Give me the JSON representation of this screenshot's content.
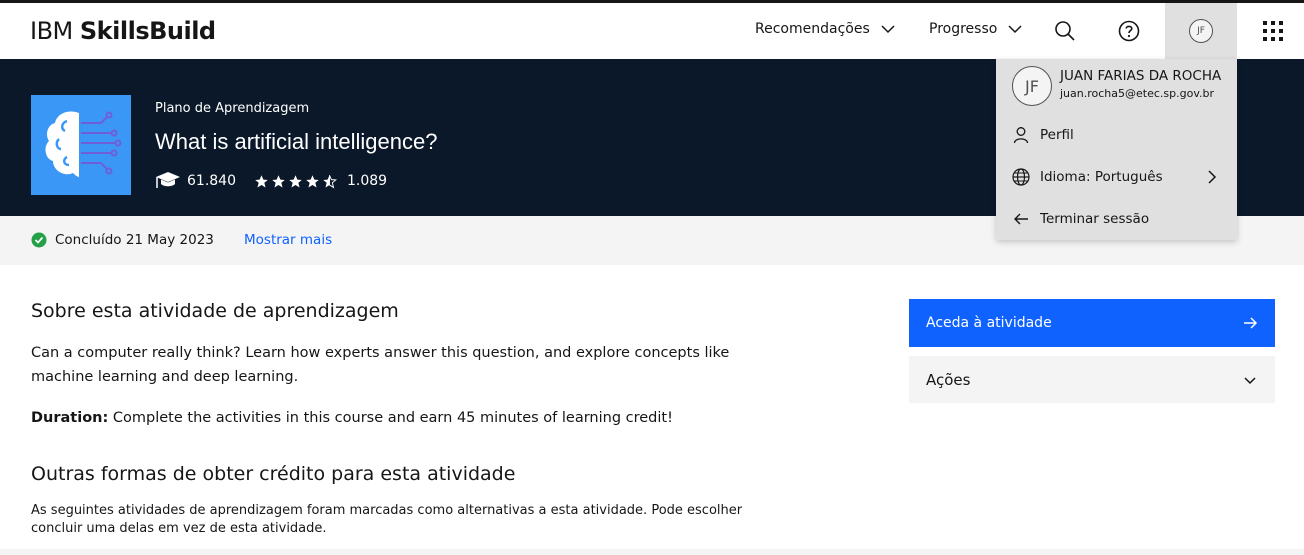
{
  "header": {
    "logo_light": "IBM ",
    "logo_bold": "SkillsBuild",
    "nav_recommendations": "Recomendações",
    "nav_progress": "Progresso",
    "avatar_initials": "JF"
  },
  "hero": {
    "kicker": "Plano de Aprendizagem",
    "title": "What is artificial intelligence?",
    "learners": "61.840",
    "rating": 4.5,
    "rating_count": "1.089"
  },
  "status": {
    "completed": "Concluído 21 May 2023",
    "show_more": "Mostrar mais"
  },
  "about": {
    "heading": "Sobre esta atividade de aprendizagem",
    "description": "Can a computer really think? Learn how experts answer this question, and explore concepts like machine learning and deep learning.",
    "duration_label": "Duration:",
    "duration_text": " Complete the activities in this course and earn 45 minutes of learning credit!"
  },
  "alternatives": {
    "heading": "Outras formas de obter crédito para esta atividade",
    "text": "As seguintes atividades de aprendizagem foram marcadas como alternativas a esta atividade. Pode escolher concluir uma delas em vez de esta atividade."
  },
  "actions": {
    "primary": "Aceda à atividade",
    "accordion": "Ações"
  },
  "dropdown": {
    "initials": "JF",
    "name": "JUAN FARIAS DA ROCHA",
    "email": "juan.rocha5@etec.sp.gov.br",
    "profile": "Perfil",
    "language": "Idioma: Português",
    "logout": "Terminar sessão"
  },
  "colors": {
    "accent": "#0f62fe",
    "hero_bg": "#0a1829",
    "success": "#24a148"
  }
}
